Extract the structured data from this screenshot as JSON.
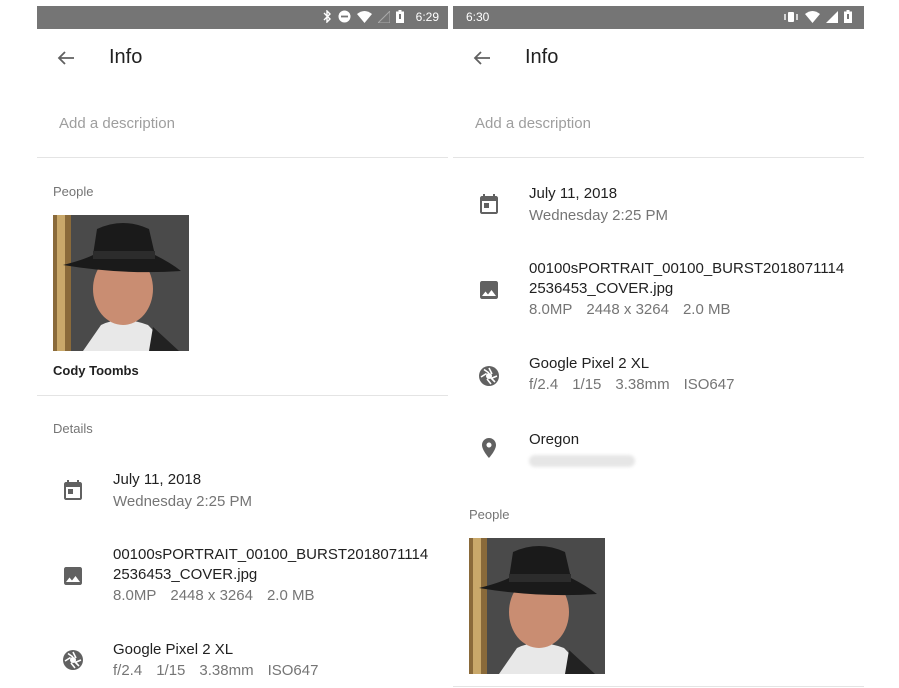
{
  "screens": [
    {
      "status_bar": {
        "time": "6:29"
      },
      "title": "Info",
      "description_placeholder": "Add a description",
      "people_label": "People",
      "person_name": "Cody Toombs",
      "details_label": "Details",
      "date": {
        "date": "July 11, 2018",
        "day_time": "Wednesday 2:25 PM"
      },
      "file": {
        "name_line1": "00100sPORTRAIT_00100_BURST2018071114",
        "name_line2": "2536453_COVER.jpg",
        "megapixels": "8.0MP",
        "resolution": "2448 x 3264",
        "size": "2.0 MB"
      },
      "camera": {
        "model": "Google Pixel 2 XL",
        "aperture": "f/2.4",
        "shutter": "1/15",
        "focal_length": "3.38mm",
        "iso": "ISO647"
      }
    },
    {
      "status_bar": {
        "time": "6:30"
      },
      "title": "Info",
      "description_placeholder": "Add a description",
      "date": {
        "date": "July 11, 2018",
        "day_time": "Wednesday 2:25 PM"
      },
      "file": {
        "name_line1": "00100sPORTRAIT_00100_BURST2018071114",
        "name_line2": "2536453_COVER.jpg",
        "megapixels": "8.0MP",
        "resolution": "2448 x 3264",
        "size": "2.0 MB"
      },
      "camera": {
        "model": "Google Pixel 2 XL",
        "aperture": "f/2.4",
        "shutter": "1/15",
        "focal_length": "3.38mm",
        "iso": "ISO647"
      },
      "location": {
        "name": "Oregon"
      },
      "people_label": "People"
    }
  ],
  "colors": {
    "status_bar": "#757575",
    "icon": "#616161",
    "divider": "#e4e4e4",
    "secondary_text": "#757575"
  },
  "icons": [
    "back-arrow-icon",
    "calendar-icon",
    "image-icon",
    "aperture-icon",
    "location-pin-icon",
    "bluetooth-icon",
    "do-not-disturb-icon",
    "wifi-icon",
    "signal-icon",
    "battery-icon",
    "vibrate-icon"
  ]
}
